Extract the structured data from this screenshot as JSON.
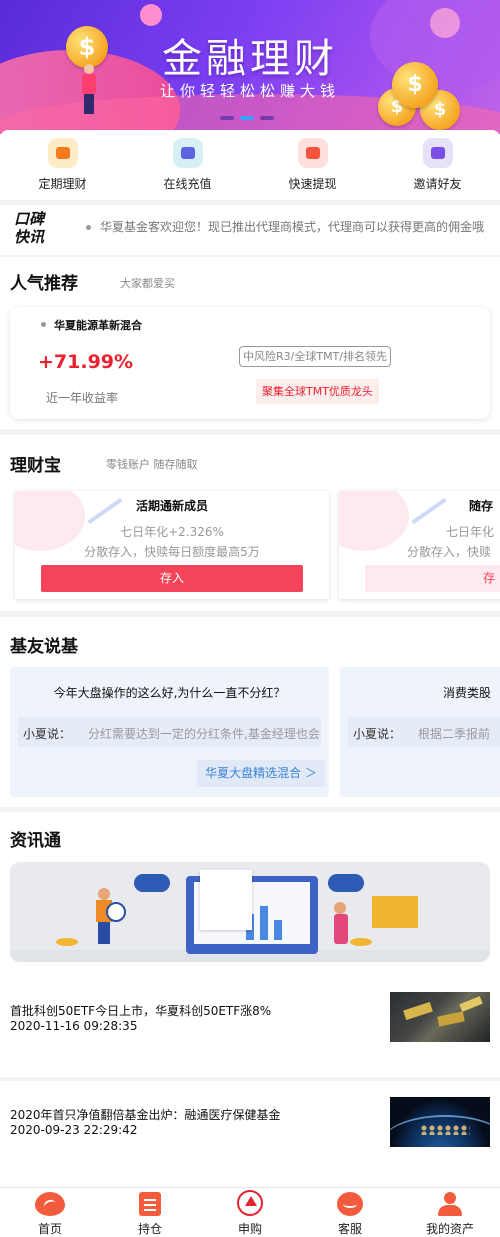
{
  "banner": {
    "title": "金融理财",
    "subtitle": "让你轻轻松松赚大钱",
    "coin_symbol": "$",
    "slide_count": 3,
    "active_slide": 2
  },
  "quick_menu": [
    {
      "label": "定期理财",
      "icon": "wallet-icon",
      "bg": "#fdecc6",
      "color": "#f57a1e"
    },
    {
      "label": "在线充值",
      "icon": "recharge-icon",
      "bg": "#d7f0f6",
      "color": "#5b63e0"
    },
    {
      "label": "快速提现",
      "icon": "withdraw-icon",
      "bg": "#fde0de",
      "color": "#f4533e"
    },
    {
      "label": "邀请好友",
      "icon": "invite-icon",
      "bg": "#e6e1f7",
      "color": "#7a4fe8"
    }
  ],
  "news_ticker": {
    "badge_line1": "口碑",
    "badge_line2": "快讯",
    "text": "华夏基金客欢迎您！现已推出代理商模式，代理商可以获得更高的佣金哦"
  },
  "popular": {
    "title": "人气推荐",
    "subtitle": "大家都爱买",
    "fund_name": "华夏能源革新混合",
    "rate": "+71.99%",
    "rate_label": "近一年收益率",
    "tag": "中风险R3/全球TMT/排名领先",
    "highlight": "聚集全球TMT优质龙头"
  },
  "licaibao": {
    "title": "理财宝",
    "subtitle": "零钱账户 随存随取",
    "cards": [
      {
        "title": "活期通新成员",
        "yield": "七日年化+2.326%",
        "desc": "分散存入，快赎每日额度最高5万",
        "button": "存入"
      },
      {
        "title": "随存",
        "yield": "七日年化",
        "desc": "分散存入，快赎",
        "button": "存"
      }
    ]
  },
  "jiyou": {
    "title": "基友说基",
    "cards": [
      {
        "question": "今年大盘操作的这么好,为什么一直不分红？",
        "who": "小夏说：",
        "answer": "分红需要达到一定的分红条件,基金经理也会",
        "link": "华夏大盘精选混合 ＞"
      },
      {
        "question": "消费类股",
        "who": "小夏说：",
        "answer": "根据二季报前",
        "link": ""
      }
    ]
  },
  "zixun": {
    "title": "资讯通",
    "items": [
      {
        "title": "首批科创50ETF今日上市，华夏科创50ETF涨8%",
        "time": "2020-11-16 09:28:35",
        "thumb": "gold-bars-image"
      },
      {
        "title": "2020年首只净值翻倍基金出炉：融通医疗保健基金",
        "time": "2020-09-23 22:29:42",
        "thumb": "earth-night-image"
      }
    ]
  },
  "tabbar": [
    {
      "label": "首页",
      "icon": "home-icon"
    },
    {
      "label": "持仓",
      "icon": "holdings-icon"
    },
    {
      "label": "申购",
      "icon": "purchase-icon"
    },
    {
      "label": "客服",
      "icon": "service-icon"
    },
    {
      "label": "我的资产",
      "icon": "profile-icon"
    }
  ]
}
